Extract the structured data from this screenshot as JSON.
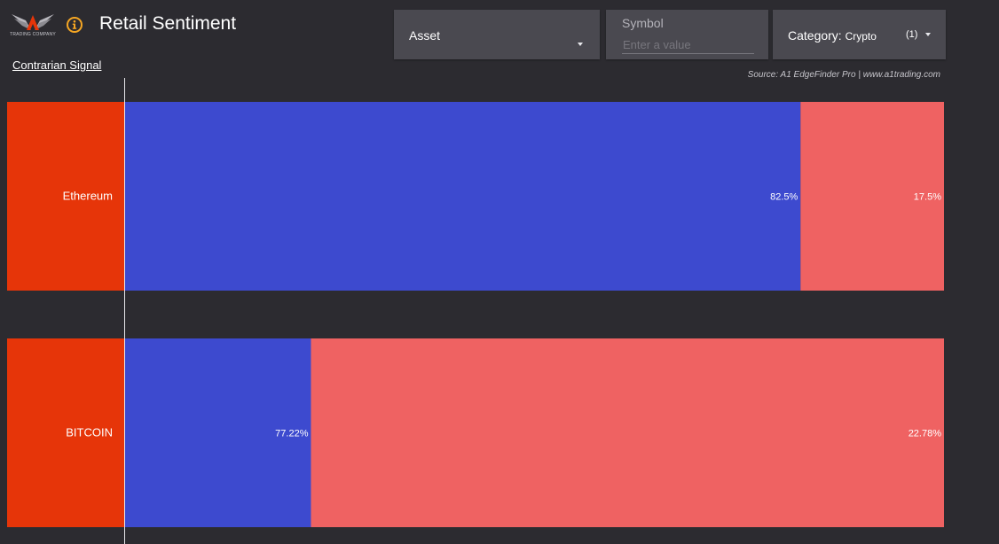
{
  "header": {
    "logo_text": "TRADING COMPANY",
    "title": "Retail Sentiment",
    "contrarian_link": "Contrarian Signal"
  },
  "controls": {
    "asset_label": "Asset",
    "symbol_label": "Symbol",
    "symbol_placeholder": "Enter a value",
    "category_label": "Category:",
    "category_value": "Crypto",
    "category_count": "(1)"
  },
  "source_text": "Source: A1 EdgeFinder Pro | www.a1trading.com",
  "icons": {
    "info": "info-circle-icon",
    "dropdown": "caret-down-icon"
  },
  "colors": {
    "background": "#2c2b30",
    "accent": "#f5a623",
    "long": "#3d4acf",
    "short": "#ef6262",
    "label_bg": "#e63509",
    "control_bg": "#4a4950"
  },
  "chart_data": {
    "type": "bar",
    "orientation": "horizontal",
    "stacked": true,
    "categories": [
      "Ethereum",
      "BITCOIN"
    ],
    "series": [
      {
        "values": [
          82.5,
          22.78
        ]
      },
      {
        "values": [
          17.5,
          22.78
        ]
      }
    ],
    "data_labels": [
      [
        "82.5%",
        "17.5%"
      ],
      [
        "77.22%",
        "22.78%"
      ]
    ],
    "xlim": [
      0,
      100
    ],
    "grid": false,
    "legend": "none"
  }
}
